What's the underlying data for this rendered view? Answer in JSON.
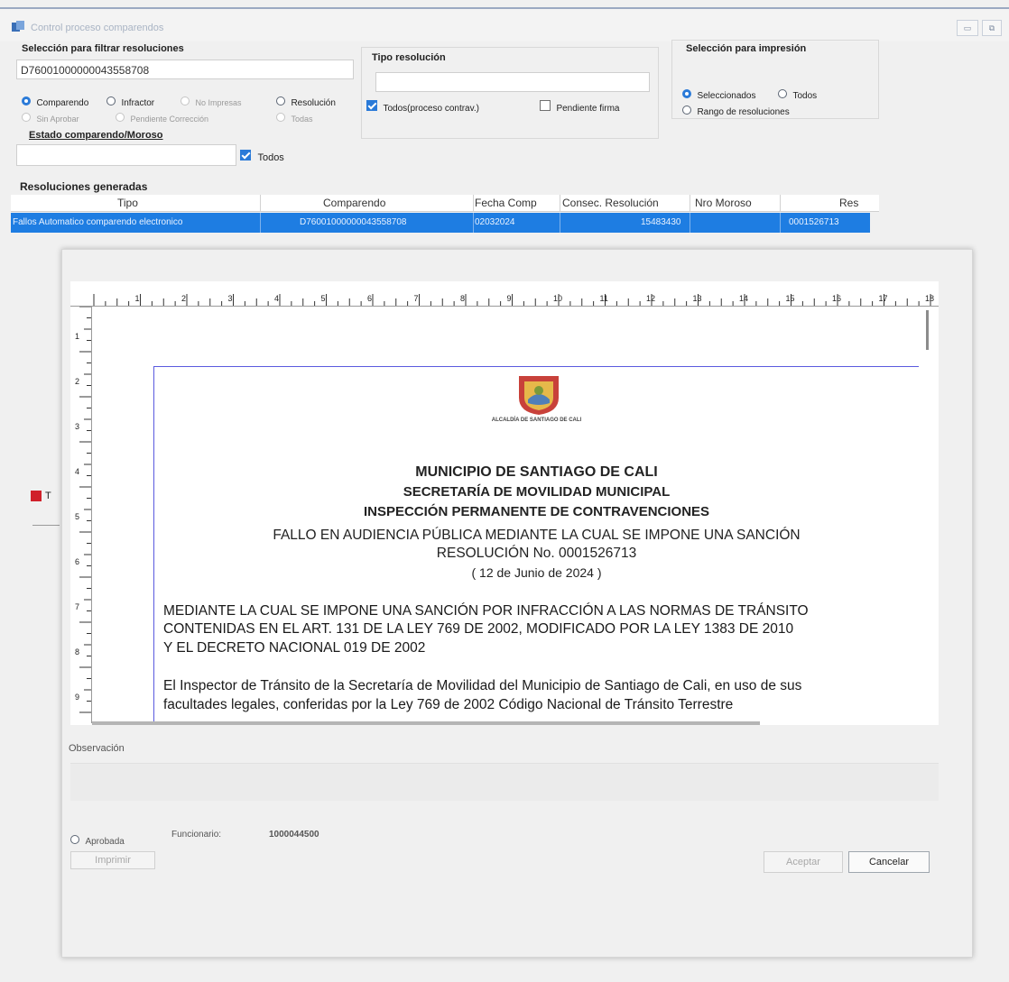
{
  "window": {
    "title": "Control proceso comparendos",
    "restore_label": "▭",
    "maximize_label": "⧉"
  },
  "filter": {
    "label": "Selección para filtrar resoluciones",
    "search_value": "D76001000000043558708",
    "radios": [
      {
        "label": "Comparendo",
        "selected": true,
        "enabled": true
      },
      {
        "label": "Infractor",
        "selected": false,
        "enabled": true
      },
      {
        "label": "No Impresas",
        "selected": false,
        "enabled": false
      },
      {
        "label": "Resolución",
        "selected": false,
        "enabled": true
      },
      {
        "label": "Sin Aprobar",
        "selected": false,
        "enabled": false
      },
      {
        "label": "Pendiente Corrección",
        "selected": false,
        "enabled": false
      },
      {
        "label": "Todas",
        "selected": false,
        "enabled": false
      }
    ],
    "estado_label": "Estado comparendo/Moroso",
    "estado_value": "",
    "todos_label": "Todos",
    "todos_checked": true
  },
  "tipo": {
    "label": "Tipo resolución",
    "value": "",
    "todos_label": "Todos(proceso contrav.)",
    "todos_checked": true,
    "pendiente_label": "Pendiente firma",
    "pendiente_checked": false
  },
  "print_selection": {
    "label": "Selección para impresión",
    "options": [
      {
        "label": "Seleccionados",
        "selected": true
      },
      {
        "label": "Todos",
        "selected": false
      },
      {
        "label": "Rango de resoluciones",
        "selected": false
      }
    ]
  },
  "grid": {
    "label": "Resoluciones generadas",
    "columns": [
      "Tipo",
      "Comparendo",
      "Fecha Comp",
      "Consec. Resolución",
      "Nro Moroso",
      "Res"
    ],
    "rows": [
      [
        "Fallos Automatico comparendo electronico",
        "D76001000000043558708",
        "02032024",
        "15483430",
        "",
        "0001526713"
      ]
    ]
  },
  "ruler": {
    "h_numbers": [
      "1",
      "2",
      "3",
      "4",
      "5",
      "6",
      "7",
      "8",
      "9",
      "10",
      "11",
      "12",
      "13",
      "14",
      "15",
      "16",
      "17",
      "18"
    ],
    "v_numbers": [
      "1",
      "2",
      "3",
      "4",
      "5",
      "6",
      "7",
      "8",
      "9"
    ]
  },
  "document": {
    "crest_caption": "ALCALDÍA DE SANTIAGO DE CALI",
    "heading1": "MUNICIPIO DE SANTIAGO DE CALI",
    "heading2": "SECRETARÍA DE MOVILIDAD MUNICIPAL",
    "heading3": "INSPECCIÓN PERMANENTE DE CONTRAVENCIONES",
    "subheading1": "FALLO EN AUDIENCIA PÚBLICA MEDIANTE LA CUAL SE IMPONE UNA SANCIÓN",
    "subheading2": "RESOLUCIÓN No. 0001526713",
    "date": "( 12 de Junio de  2024 )",
    "para1_line1": "MEDIANTE LA CUAL SE IMPONE UNA SANCIÓN POR INFRACCIÓN A LAS NORMAS DE TRÁNSITO",
    "para1_line2": "CONTENIDAS EN EL ART. 131 DE LA LEY 769 DE 2002, MODIFICADO POR LA LEY 1383 DE 2010",
    "para1_line3": "Y EL DECRETO NACIONAL 019 DE 2002",
    "para2_line1": "El Inspector de Tránsito de la Secretaría de Movilidad del Municipio de Santiago de Cali, en uso de sus",
    "para2_line2": "facultades legales, conferidas por la Ley 769 de 2002 Código Nacional de Tránsito Terrestre"
  },
  "dialog": {
    "observation_label": "Observación",
    "observation_value": "",
    "aprobada_label": "Aprobada",
    "funcionario_label": "Funcionario:",
    "funcionario_value": "1000044500",
    "imprimir_label": "Imprimir",
    "aceptar_label": "Aceptar",
    "cancelar_label": "Cancelar"
  },
  "background_fragment": {
    "label": "T"
  },
  "colors": {
    "selection": "#1e7de2",
    "accent": "#2a7ad8",
    "page_border": "#5a5adf"
  }
}
